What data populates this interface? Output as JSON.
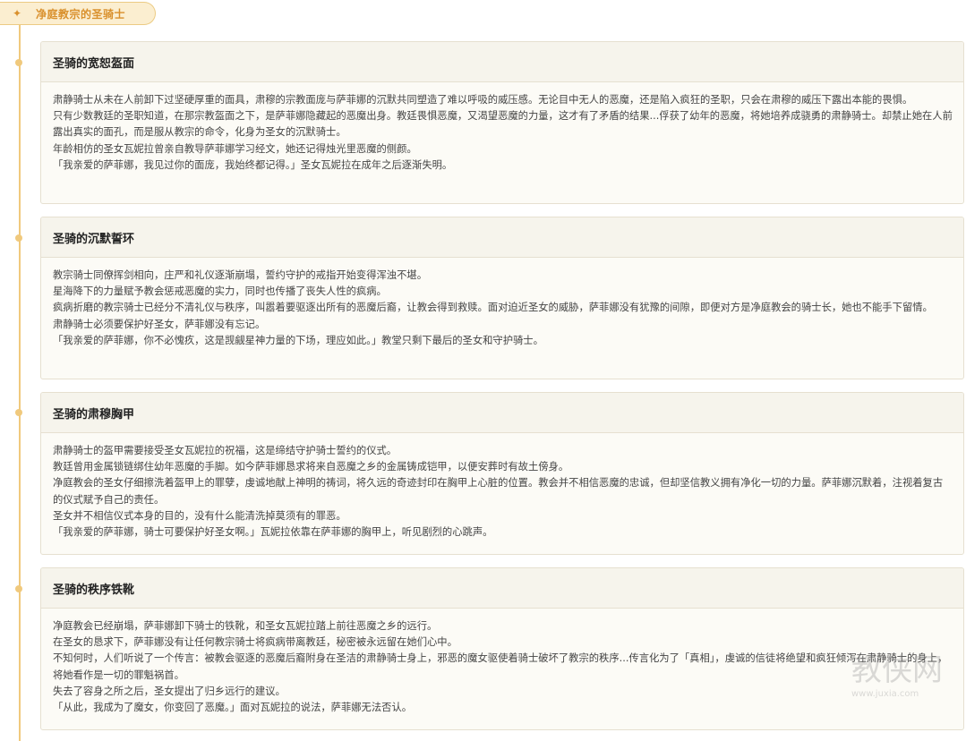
{
  "header": {
    "title": "净庭教宗的圣骑士",
    "star_icon": "✦"
  },
  "colors": {
    "accent": "#d9902c",
    "timeline": "#f0c97d",
    "card_bg": "#fcfbf6",
    "header_bg": "#f6f4ec"
  },
  "cards": [
    {
      "title": "圣骑的宽恕盔面",
      "lines": [
        "肃静骑士从未在人前卸下过坚硬厚重的面具，肃穆的宗教面庞与萨菲娜的沉默共同塑造了难以呼吸的威压感。无论目中无人的恶魔，还是陷入疯狂的圣职，只会在肃穆的威压下露出本能的畏惧。",
        "只有少数教廷的圣职知道，在那宗教盔面之下，是萨菲娜隐藏起的恶魔出身。教廷畏惧恶魔，又渴望恶魔的力量，这才有了矛盾的结果...俘获了幼年的恶魔，将她培养成骁勇的肃静骑士。却禁止她在人前露出真实的面孔，而是服从教宗的命令，化身为圣女的沉默骑士。",
        "年龄相仿的圣女瓦妮拉曾亲自教导萨菲娜学习经文，她还记得烛光里恶魔的侧颜。",
        "「我亲爱的萨菲娜，我见过你的面庞，我始终都记得。」圣女瓦妮拉在成年之后逐渐失明。"
      ]
    },
    {
      "title": "圣骑的沉默誓环",
      "lines": [
        "教宗骑士同僚挥剑相向，庄严和礼仪逐渐崩塌，誓约守护的戒指开始变得浑浊不堪。",
        "星海降下的力量赋予教会惩戒恶魔的实力，同时也传播了丧失人性的疯病。",
        "疯病折磨的教宗骑士已经分不清礼仪与秩序，叫嚣着要驱逐出所有的恶魔后裔，让教会得到救赎。面对迫近圣女的威胁，萨菲娜没有犹豫的间隙，即便对方是净庭教会的骑士长，她也不能手下留情。",
        "肃静骑士必须要保护好圣女，萨菲娜没有忘记。",
        "「我亲爱的萨菲娜，你不必愧疚，这是觊觎星神力量的下场，理应如此。」教堂只剩下最后的圣女和守护骑士。"
      ]
    },
    {
      "title": "圣骑的肃穆胸甲",
      "lines": [
        "肃静骑士的盔甲需要接受圣女瓦妮拉的祝福，这是缔结守护骑士誓约的仪式。",
        "教廷曾用金属锁链绑住幼年恶魔的手脚。如今萨菲娜恳求将来自恶魔之乡的金属铸成铠甲，以便安葬时有故土傍身。",
        "净庭教会的圣女仔细擦洗着盔甲上的罪孽，虔诚地献上神明的祷词，将久远的奇迹封印在胸甲上心脏的位置。教会并不相信恶魔的忠诚，但却坚信教义拥有净化一切的力量。萨菲娜沉默着，注视着复古的仪式赋予自己的责任。",
        "圣女并不相信仪式本身的目的，没有什么能清洗掉莫须有的罪恶。",
        "「我亲爱的萨菲娜，骑士可要保护好圣女啊。」瓦妮拉依靠在萨菲娜的胸甲上，听见剧烈的心跳声。"
      ]
    },
    {
      "title": "圣骑的秩序铁靴",
      "lines": [
        "净庭教会已经崩塌，萨菲娜卸下骑士的铁靴，和圣女瓦妮拉踏上前往恶魔之乡的远行。",
        "在圣女的恳求下，萨菲娜没有让任何教宗骑士将疯病带离教廷，秘密被永远留在她们心中。",
        "不知何时，人们听说了一个传言：被教会驱逐的恶魔后裔附身在圣洁的肃静骑士身上，邪恶的魔女驱使着骑士破坏了教宗的秩序...传言化为了「真相」，虔诚的信徒将绝望和疯狂倾泻在肃静骑士的身上，将她看作是一切的罪魁祸首。",
        "失去了容身之所之后，圣女提出了归乡远行的建议。",
        "「从此，我成为了魔女，你变回了恶魔。」面对瓦妮拉的说法，萨菲娜无法否认。"
      ]
    }
  ],
  "watermark": {
    "text": "教侠网",
    "url": "www.juxia.com"
  }
}
